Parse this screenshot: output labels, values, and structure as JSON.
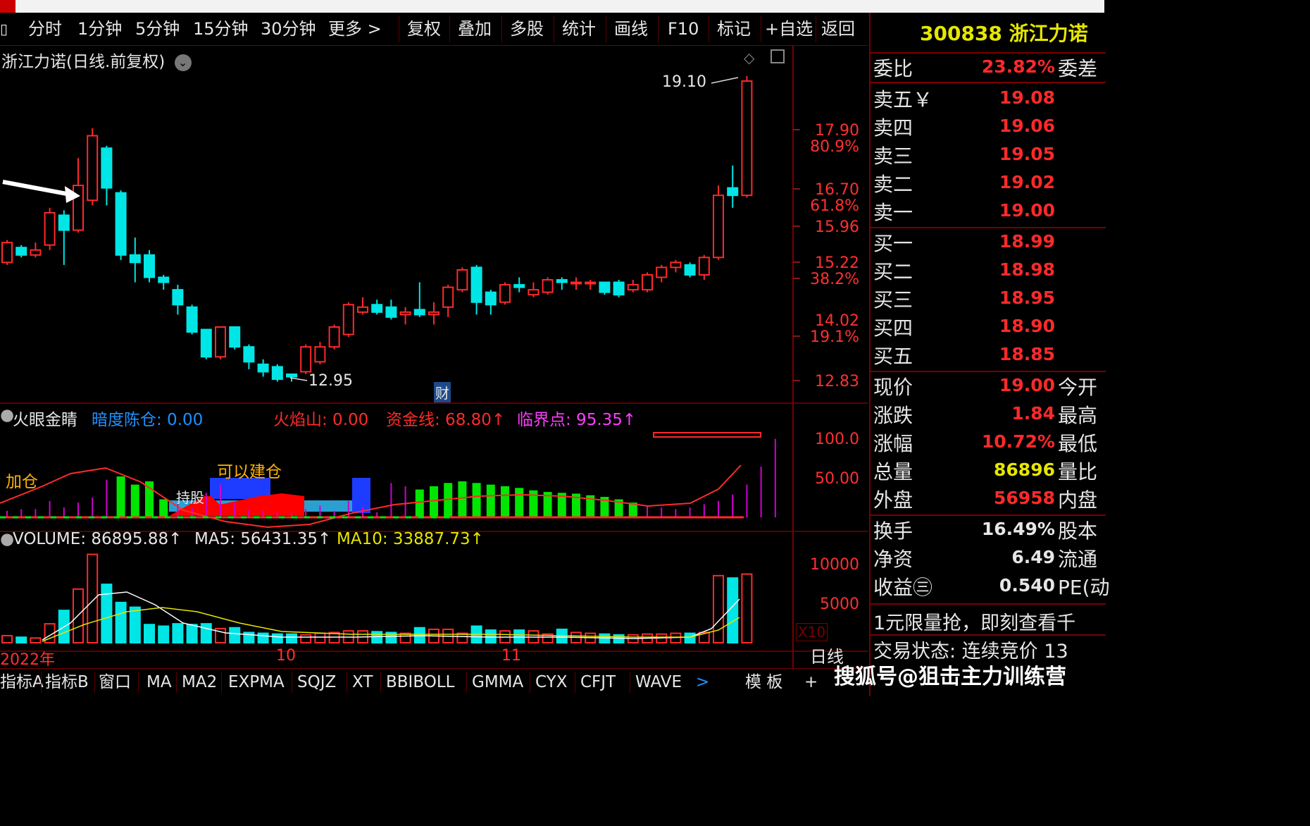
{
  "colors": {
    "up": "#ff2a2a",
    "down": "#00e6e6",
    "axis": "#ff3030",
    "bg": "#000000",
    "ma5": "#ffffff",
    "ma10": "#e6e600"
  },
  "toolbar": {
    "periods": [
      "分时",
      "1分钟",
      "5分钟",
      "15分钟",
      "30分钟",
      "更多 >"
    ],
    "actions": [
      "复权",
      "叠加",
      "多股",
      "统计",
      "画线",
      "F10",
      "标记",
      "+自选",
      "返回"
    ]
  },
  "chart_title": "浙江力诺(日线.前复权)",
  "price_axis": [
    {
      "v": "17.90"
    },
    {
      "v": "80.9%"
    },
    {
      "v": "16.70"
    },
    {
      "v": "61.8%"
    },
    {
      "v": "15.96"
    },
    {
      "v": "15.22"
    },
    {
      "v": "38.2%"
    },
    {
      "v": "14.02"
    },
    {
      "v": "19.1%"
    },
    {
      "v": "12.83"
    }
  ],
  "annotations": {
    "high": "19.10",
    "low": "12.95",
    "cai": "财"
  },
  "indicator": {
    "name": "火眼金睛",
    "items": [
      {
        "label": "暗度陈仓: 0.00",
        "color": "#1e90ff"
      },
      {
        "label": "火焰山: 0.00",
        "color": "#ff2a2a"
      },
      {
        "label": "资金线: 68.80↑",
        "color": "#ff2a2a"
      },
      {
        "label": "临界点: 95.35↑",
        "color": "#ff3cff"
      }
    ],
    "axis": [
      "100.0",
      "50.00"
    ],
    "labels": {
      "jiacang": "加仓",
      "keyi": "可以建仓",
      "chigu": "持股"
    }
  },
  "volume": {
    "items": [
      {
        "label": "VOLUME: 86895.88↑",
        "color": "#e6e6e6"
      },
      {
        "label": "MA5: 56431.35↑",
        "color": "#e6e6e6"
      },
      {
        "label": "MA10: 33887.73↑",
        "color": "#e6e600"
      }
    ],
    "axis": [
      "10000",
      "5000"
    ],
    "multiplier": "X10"
  },
  "time_axis": [
    "2022年",
    "10",
    "11"
  ],
  "right_panel": {
    "header": "300838 浙江力诺",
    "weibi": {
      "label": "委比",
      "value": "23.82%",
      "extra": "委差"
    },
    "sells": [
      {
        "label": "卖五￥",
        "price": "19.08"
      },
      {
        "label": "卖四",
        "price": "19.06"
      },
      {
        "label": "卖三",
        "price": "19.05"
      },
      {
        "label": "卖二",
        "price": "19.02"
      },
      {
        "label": "卖一",
        "price": "19.00"
      }
    ],
    "buys": [
      {
        "label": "买一",
        "price": "18.99"
      },
      {
        "label": "买二",
        "price": "18.98"
      },
      {
        "label": "买三",
        "price": "18.95"
      },
      {
        "label": "买四",
        "price": "18.90"
      },
      {
        "label": "买五",
        "price": "18.85"
      }
    ],
    "stats": [
      {
        "label": "现价",
        "value": "19.00",
        "extra": "今开",
        "color": "#ff2a2a"
      },
      {
        "label": "涨跌",
        "value": "1.84",
        "extra": "最高",
        "color": "#ff2a2a"
      },
      {
        "label": "涨幅",
        "value": "10.72%",
        "extra": "最低",
        "color": "#ff2a2a"
      },
      {
        "label": "总量",
        "value": "86896",
        "extra": "量比",
        "color": "#e6e600"
      },
      {
        "label": "外盘",
        "value": "56958",
        "extra": "内盘",
        "color": "#ff2a2a"
      }
    ],
    "stats2": [
      {
        "label": "换手",
        "value": "16.49%",
        "extra": "股本",
        "color": "#e6e6e6"
      },
      {
        "label": "净资",
        "value": "6.49",
        "extra": "流通",
        "color": "#e6e6e6"
      },
      {
        "label": "收益㊂",
        "value": "0.540",
        "extra": "PE(动",
        "color": "#e6e6e6"
      }
    ],
    "promo": "1元限量抢，即刻查看千",
    "status": "交易状态: 连续竞价 13",
    "footer": "日线"
  },
  "bottom_tabs": [
    "指标A",
    "指标B",
    "窗口",
    "MA",
    "MA2",
    "EXPMA",
    "SQJZ",
    "XT",
    "BBIBOLL",
    "GMMA",
    "CYX",
    "CFJT",
    "WAVE",
    ">",
    "模 板",
    "+"
  ],
  "watermark": "搜狐号@狙击主力训练营",
  "chart_data": {
    "type": "candlestick",
    "title": "浙江力诺(日线.前复权)",
    "candles": [
      {
        "o": 15.35,
        "c": 15.75,
        "h": 15.8,
        "l": 15.3
      },
      {
        "o": 15.65,
        "c": 15.5,
        "h": 15.7,
        "l": 15.45
      },
      {
        "o": 15.5,
        "c": 15.6,
        "h": 15.75,
        "l": 15.45
      },
      {
        "o": 15.7,
        "c": 16.35,
        "h": 16.45,
        "l": 15.6
      },
      {
        "o": 16.3,
        "c": 16.0,
        "h": 16.4,
        "l": 15.3
      },
      {
        "o": 16.0,
        "c": 16.9,
        "h": 17.45,
        "l": 15.95
      },
      {
        "o": 16.6,
        "c": 17.9,
        "h": 18.05,
        "l": 16.5
      },
      {
        "o": 17.65,
        "c": 16.85,
        "h": 17.7,
        "l": 16.5
      },
      {
        "o": 16.75,
        "c": 15.5,
        "h": 16.8,
        "l": 15.4
      },
      {
        "o": 15.5,
        "c": 15.35,
        "h": 15.85,
        "l": 14.95
      },
      {
        "o": 15.5,
        "c": 15.05,
        "h": 15.6,
        "l": 14.95
      },
      {
        "o": 15.05,
        "c": 14.95,
        "h": 15.1,
        "l": 14.8
      },
      {
        "o": 14.8,
        "c": 14.5,
        "h": 14.9,
        "l": 14.3
      },
      {
        "o": 14.45,
        "c": 13.95,
        "h": 14.5,
        "l": 13.9
      },
      {
        "o": 14.0,
        "c": 13.45,
        "h": 14.0,
        "l": 13.4
      },
      {
        "o": 13.45,
        "c": 14.05,
        "h": 14.05,
        "l": 13.4
      },
      {
        "o": 14.05,
        "c": 13.65,
        "h": 14.05,
        "l": 13.6
      },
      {
        "o": 13.65,
        "c": 13.35,
        "h": 13.7,
        "l": 13.2
      },
      {
        "o": 13.3,
        "c": 13.15,
        "h": 13.4,
        "l": 13.05
      },
      {
        "o": 13.25,
        "c": 13.0,
        "h": 13.3,
        "l": 12.95
      },
      {
        "o": 13.1,
        "c": 13.05,
        "h": 13.1,
        "l": 12.95
      },
      {
        "o": 13.15,
        "c": 13.65,
        "h": 13.7,
        "l": 13.1
      },
      {
        "o": 13.35,
        "c": 13.65,
        "h": 13.75,
        "l": 13.3
      },
      {
        "o": 13.65,
        "c": 14.05,
        "h": 14.1,
        "l": 13.6
      },
      {
        "o": 13.9,
        "c": 14.5,
        "h": 14.55,
        "l": 13.85
      },
      {
        "o": 14.35,
        "c": 14.45,
        "h": 14.65,
        "l": 14.3
      },
      {
        "o": 14.5,
        "c": 14.35,
        "h": 14.6,
        "l": 14.3
      },
      {
        "o": 14.45,
        "c": 14.25,
        "h": 14.6,
        "l": 14.2
      },
      {
        "o": 14.3,
        "c": 14.35,
        "h": 14.45,
        "l": 14.1
      },
      {
        "o": 14.4,
        "c": 14.3,
        "h": 14.95,
        "l": 14.25
      },
      {
        "o": 14.3,
        "c": 14.35,
        "h": 14.55,
        "l": 14.1
      },
      {
        "o": 14.45,
        "c": 14.85,
        "h": 14.9,
        "l": 14.25
      },
      {
        "o": 14.8,
        "c": 15.2,
        "h": 15.25,
        "l": 14.75
      },
      {
        "o": 15.25,
        "c": 14.55,
        "h": 15.3,
        "l": 14.3
      },
      {
        "o": 14.75,
        "c": 14.5,
        "h": 14.8,
        "l": 14.3
      },
      {
        "o": 14.55,
        "c": 14.9,
        "h": 14.95,
        "l": 14.5
      },
      {
        "o": 14.9,
        "c": 14.85,
        "h": 15.05,
        "l": 14.75
      },
      {
        "o": 14.7,
        "c": 14.8,
        "h": 14.95,
        "l": 14.65
      },
      {
        "o": 14.75,
        "c": 15.0,
        "h": 15.05,
        "l": 14.7
      },
      {
        "o": 15.0,
        "c": 14.95,
        "h": 15.05,
        "l": 14.8
      },
      {
        "o": 14.95,
        "c": 14.95,
        "h": 15.05,
        "l": 14.8
      },
      {
        "o": 14.95,
        "c": 14.95,
        "h": 15.0,
        "l": 14.8
      },
      {
        "o": 14.95,
        "c": 14.75,
        "h": 14.95,
        "l": 14.7
      },
      {
        "o": 14.95,
        "c": 14.7,
        "h": 15.0,
        "l": 14.65
      },
      {
        "o": 14.8,
        "c": 14.9,
        "h": 15.0,
        "l": 14.75
      },
      {
        "o": 14.8,
        "c": 15.1,
        "h": 15.15,
        "l": 14.75
      },
      {
        "o": 15.05,
        "c": 15.25,
        "h": 15.3,
        "l": 14.95
      },
      {
        "o": 15.25,
        "c": 15.35,
        "h": 15.4,
        "l": 15.15
      },
      {
        "o": 15.3,
        "c": 15.1,
        "h": 15.35,
        "l": 15.05
      },
      {
        "o": 15.1,
        "c": 15.45,
        "h": 15.5,
        "l": 15.0
      },
      {
        "o": 15.45,
        "c": 16.7,
        "h": 16.9,
        "l": 15.4
      },
      {
        "o": 16.85,
        "c": 16.7,
        "h": 17.3,
        "l": 16.45
      },
      {
        "o": 16.7,
        "c": 19.0,
        "h": 19.1,
        "l": 16.65
      }
    ],
    "indicator_bars": [
      8,
      10,
      10,
      20,
      12,
      18,
      24,
      46,
      50,
      40,
      44,
      22,
      18,
      12,
      30,
      40,
      18,
      10,
      8,
      7,
      6,
      10,
      14,
      8,
      20,
      12,
      6,
      42,
      38,
      34,
      38,
      42,
      44,
      42,
      40,
      38,
      36,
      33,
      31,
      30,
      29,
      27,
      25,
      22,
      18,
      14,
      12,
      10,
      12,
      16,
      20,
      28,
      40,
      62,
      96
    ],
    "volume": [
      900,
      700,
      600,
      2400,
      4100,
      6800,
      11200,
      7400,
      5100,
      4500,
      2300,
      2100,
      2400,
      2300,
      2400,
      1800,
      1900,
      1300,
      1200,
      1100,
      1100,
      1000,
      1200,
      1300,
      1500,
      1500,
      1400,
      1300,
      1200,
      1900,
      1700,
      1700,
      1200,
      2100,
      1600,
      1500,
      1600,
      1500,
      1100,
      1700,
      1300,
      1200,
      1100,
      1000,
      1000,
      1100,
      1100,
      1200,
      1200,
      1300,
      8500,
      8200,
      8700
    ],
    "yrange": [
      12.83,
      19.1
    ]
  }
}
